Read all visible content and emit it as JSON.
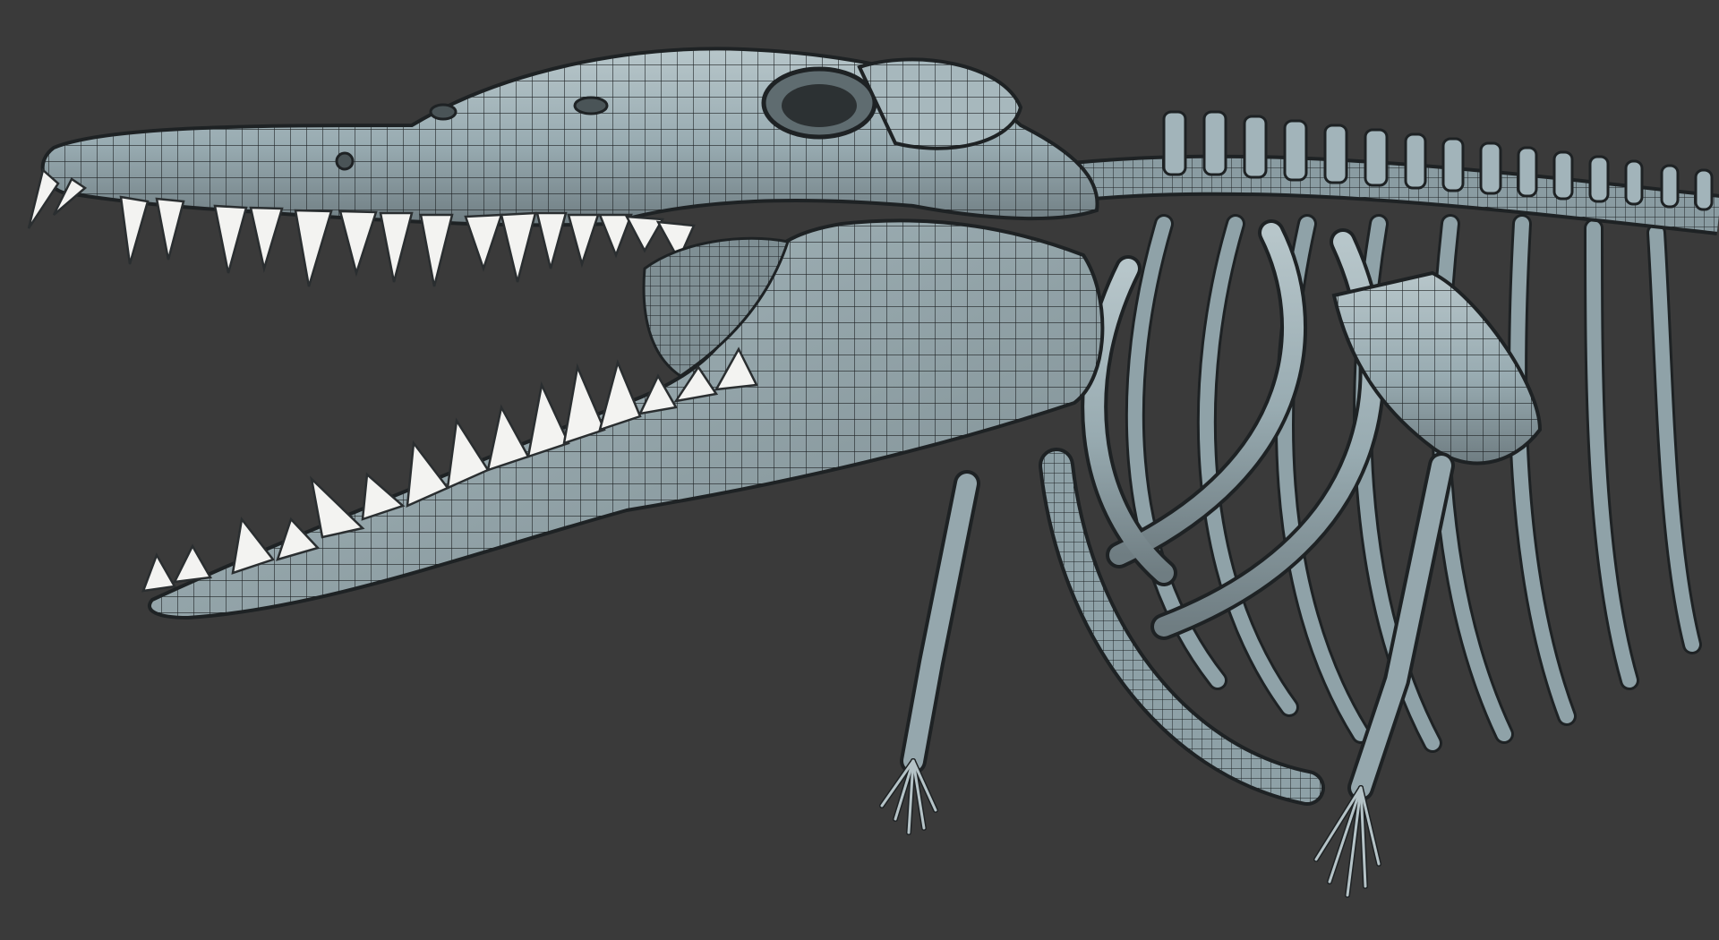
{
  "viewport": {
    "background_color": "#3a3a3a",
    "model_surface_color": "#9fb2b8",
    "model_shadow_color": "#6e7a7e",
    "wireframe_color": "#1e2224",
    "teeth_color": "#f3f3f1",
    "subject": "skeleton-wireframe-mesh"
  }
}
